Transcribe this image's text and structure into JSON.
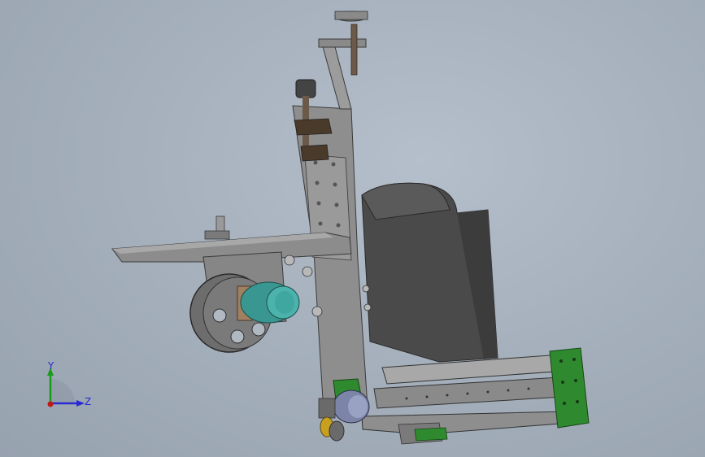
{
  "viewport": {
    "background_top": "#b4bfcb",
    "background_bottom": "#97a2af"
  },
  "model": {
    "frame_color": "#8a8a8a",
    "dark_block_color": "#4a4a4a",
    "motor_color": "#3fa6a0",
    "bracket_color": "#2f8a2f",
    "wheel_color": "#6d6d6d"
  },
  "triad": {
    "y_label": "Y",
    "z_label": "Z",
    "y_color": "#1a9a1a",
    "z_color": "#2a2ad0",
    "origin_color": "#c01818"
  }
}
